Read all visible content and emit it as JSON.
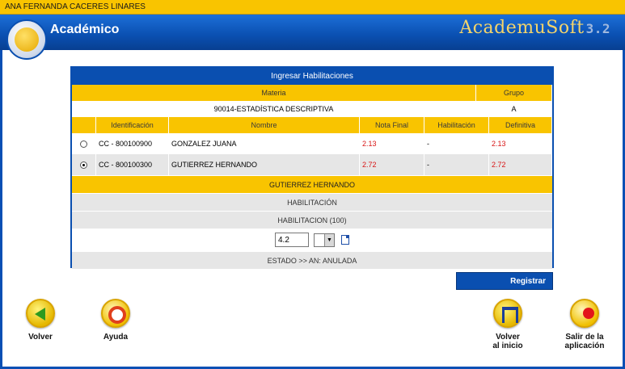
{
  "user": {
    "name": "ANA FERNANDA CACERES LINARES"
  },
  "header": {
    "title": "Académico",
    "brand": "AcademuSoft",
    "version": "3.2"
  },
  "panel": {
    "title": "Ingresar Habilitaciones",
    "course_headers": {
      "materia": "Materia",
      "grupo": "Grupo"
    },
    "course": {
      "materia": "90014-ESTADÍSTICA DESCRIPTIVA",
      "grupo": "A"
    },
    "table_headers": [
      "Identificación",
      "Nombre",
      "Nota Final",
      "Habilitación",
      "Definitiva"
    ],
    "students": [
      {
        "id": "CC - 800100900",
        "name": "GONZALEZ JUANA",
        "nota_final": "2.13",
        "habilitacion": "-",
        "definitiva": "2.13",
        "selected": false
      },
      {
        "id": "CC - 800100300",
        "name": "GUTIERREZ HERNANDO",
        "nota_final": "2.72",
        "habilitacion": "-",
        "definitiva": "2.72",
        "selected": true
      }
    ],
    "selected_student": "GUTIERREZ HERNANDO",
    "section_label": "HABILITACIÓN",
    "sub_label": "HABILITACION (100)",
    "grade_value": "4.2",
    "estado": "ESTADO >> AN: ANULADA"
  },
  "actions": {
    "register": "Registrar"
  },
  "nav": {
    "back": "Volver",
    "help": "Ayuda",
    "home_line1": "Volver",
    "home_line2": "al inicio",
    "exit_line1": "Salir de la",
    "exit_line2": "aplicación"
  },
  "colors": {
    "header_blue": "#0a4fb0",
    "accent_yellow": "#f9c400",
    "grade_red": "#d81515"
  }
}
